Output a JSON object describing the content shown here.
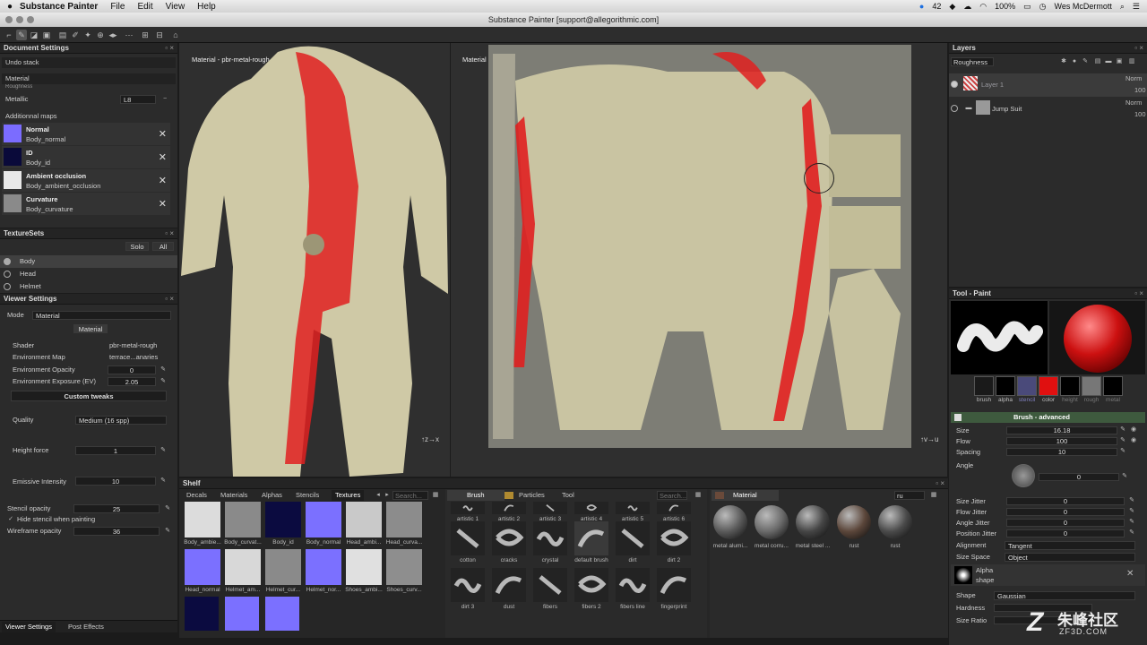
{
  "menubar": {
    "app": "Substance Painter",
    "items": [
      "File",
      "Edit",
      "View",
      "Help"
    ],
    "status_count": "42",
    "battery": "100%",
    "user": "Wes McDermott"
  },
  "window": {
    "title": "Substance Painter [support@allegorithmic.com]"
  },
  "document_settings": {
    "title": "Document Settings",
    "undo_stack": "Undo stack",
    "material": "Material",
    "partial_label": "Roughness",
    "metallic_label": "Metallic",
    "metallic_value": "L8",
    "additional_maps_label": "Additionnal maps",
    "maps": [
      {
        "name": "Normal",
        "file": "Body_normal",
        "color": "#7b6cff"
      },
      {
        "name": "ID",
        "file": "Body_id",
        "color": "#0a0a3a"
      },
      {
        "name": "Ambient occlusion",
        "file": "Body_ambient_occlusion",
        "color": "#e8e8e8"
      },
      {
        "name": "Curvature",
        "file": "Body_curvature",
        "color": "#8a8a8a"
      }
    ]
  },
  "texture_sets": {
    "title": "TextureSets",
    "solo": "Solo",
    "all": "All",
    "items": [
      "Body",
      "Head",
      "Helmet"
    ]
  },
  "viewer_settings": {
    "title": "Viewer Settings",
    "mode_label": "Mode",
    "mode_value": "Material",
    "material_button": "Material",
    "shader_label": "Shader",
    "shader_value": "pbr-metal-rough",
    "env_map_label": "Environment Map",
    "env_map_value": "terrace...anaries",
    "env_opacity_label": "Environment Opacity",
    "env_opacity_value": "0",
    "env_exposure_label": "Environment Exposure (EV)",
    "env_exposure_value": "2.05",
    "custom_tweaks": "Custom tweaks",
    "quality_label": "Quality",
    "quality_value": "Medium (16 spp)",
    "height_force_label": "Height force",
    "height_force_value": "1",
    "emissive_label": "Emissive Intensity",
    "emissive_value": "10",
    "stencil_opacity_label": "Stencil opacity",
    "stencil_opacity_value": "25",
    "hide_stencil_label": "Hide stencil when painting",
    "wireframe_label": "Wireframe opacity",
    "wireframe_value": "36",
    "bottom_tabs": [
      "Viewer Settings",
      "Post Effects"
    ]
  },
  "viewports": {
    "left_label": "Material - pbr-metal-rough",
    "right_label": "Material - pbr-metal-rough"
  },
  "shelf": {
    "title": "Shelf",
    "tabs": [
      "Decals",
      "Materials",
      "Alphas",
      "Stencils",
      "Textures"
    ],
    "search_placeholder": "Search...",
    "textures": [
      {
        "label": "Body_ambie...",
        "color": "#dcdcdc"
      },
      {
        "label": "Body_curvat...",
        "color": "#8a8a8a"
      },
      {
        "label": "Body_id",
        "color": "#0b0b40"
      },
      {
        "label": "Body_normal",
        "color": "#7b70ff"
      },
      {
        "label": "Head_ambi...",
        "color": "#c9c9c9"
      },
      {
        "label": "Head_curva...",
        "color": "#8c8c8c"
      },
      {
        "label": "Head_normal",
        "color": "#7b70ff"
      },
      {
        "label": "Helmet_am...",
        "color": "#d8d8d8"
      },
      {
        "label": "Helmet_cur...",
        "color": "#8a8a8a"
      },
      {
        "label": "Helmet_nor...",
        "color": "#7b70ff"
      },
      {
        "label": "Shoes_ambi...",
        "color": "#e0e0e0"
      },
      {
        "label": "Shoes_curv...",
        "color": "#8e8e8e"
      }
    ],
    "brush_tabs": [
      "Brush",
      "Particles",
      "Tool"
    ],
    "brush_search_placeholder": "Search...",
    "brushes": [
      "artistic 1",
      "artistic 2",
      "artistic 3",
      "artistic 4",
      "artistic 5",
      "artistic 6",
      "cotton",
      "cracks",
      "crystal",
      "default brush",
      "dirt",
      "dirt 2",
      "dirt 3",
      "dust",
      "fibers",
      "fibers 2",
      "fibers line",
      "fingerprint"
    ],
    "material_tab": "Material",
    "material_search": "ru",
    "materials": [
      {
        "label": "metal alumi...",
        "color": "#5a5a5a"
      },
      {
        "label": "metal corru...",
        "color": "#6a6a6a"
      },
      {
        "label": "metal steel ...",
        "color": "#454545"
      },
      {
        "label": "rust",
        "color": "#5b463a"
      },
      {
        "label": "rust",
        "color": "#4a4a4a"
      }
    ]
  },
  "layers": {
    "title": "Layers",
    "channel": "Roughness",
    "items": [
      {
        "name": "Layer 1",
        "blend": "Norm",
        "opacity": "100"
      },
      {
        "name": "Jump Suit",
        "blend": "Norm",
        "opacity": "100"
      }
    ]
  },
  "tool_paint": {
    "title": "Tool - Paint",
    "channels": [
      {
        "label": "brush",
        "color": "#1a1a1a",
        "label_color": "#bbbbbb"
      },
      {
        "label": "alpha",
        "color": "#000000",
        "label_color": "#bbbbbb"
      },
      {
        "label": "stencil",
        "color": "#4a4a7a",
        "label_color": "#8080c0"
      },
      {
        "label": "color",
        "color": "#e01010",
        "label_color": "#bbbbbb"
      },
      {
        "label": "height",
        "color": "#000000",
        "label_color": "#777777"
      },
      {
        "label": "rough",
        "color": "#777777",
        "label_color": "#777777"
      },
      {
        "label": "metal",
        "color": "#000000",
        "label_color": "#777777"
      }
    ],
    "brush_advanced": "Brush - advanced",
    "size_label": "Size",
    "size_value": "16.18",
    "flow_label": "Flow",
    "flow_value": "100",
    "spacing_label": "Spacing",
    "spacing_value": "10",
    "angle_label": "Angle",
    "angle_value": "0",
    "size_jitter_label": "Size Jitter",
    "size_jitter_value": "0",
    "flow_jitter_label": "Flow Jitter",
    "flow_jitter_value": "0",
    "angle_jitter_label": "Angle Jitter",
    "angle_jitter_value": "0",
    "position_jitter_label": "Position Jitter",
    "position_jitter_value": "0",
    "alignment_label": "Alignment",
    "alignment_value": "Tangent",
    "size_space_label": "Size Space",
    "size_space_value": "Object",
    "alpha_label": "Alpha",
    "alpha_sub": "shape",
    "shape_label": "Shape",
    "shape_value": "Gaussian",
    "hardness_label": "Hardness",
    "size_ratio_label": "Size Ratio"
  },
  "watermark": {
    "cn": "朱峰社区",
    "url": "ZF3D.COM"
  }
}
